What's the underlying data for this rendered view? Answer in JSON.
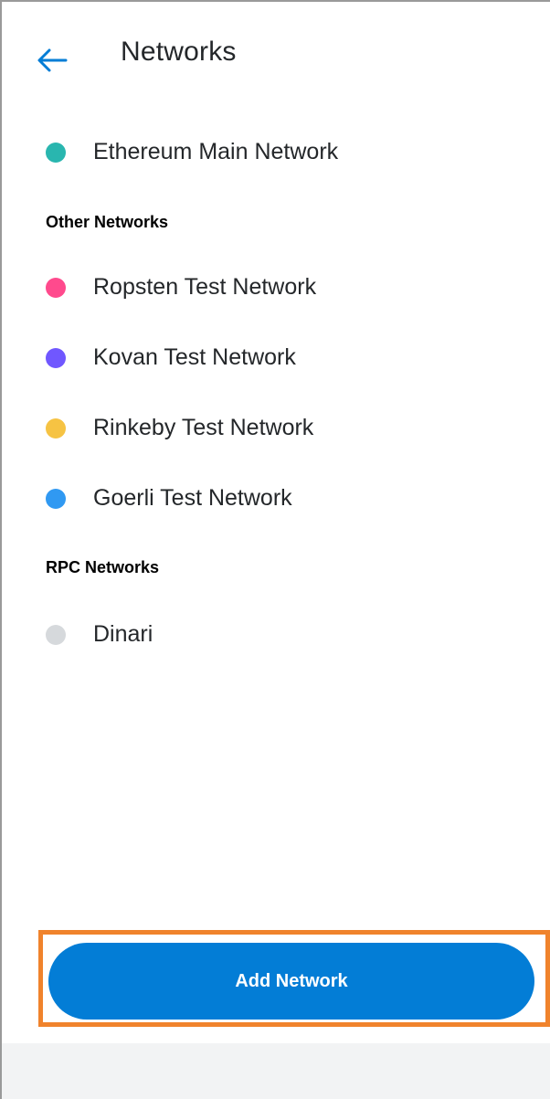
{
  "header": {
    "title": "Networks",
    "back_icon": "arrow-left-icon"
  },
  "main_network": {
    "label": "Ethereum Main Network",
    "color": "#29b6af"
  },
  "other_networks": {
    "heading": "Other Networks",
    "items": [
      {
        "label": "Ropsten Test Network",
        "color": "#ff4a8d"
      },
      {
        "label": "Kovan Test Network",
        "color": "#7057ff"
      },
      {
        "label": "Rinkeby Test Network",
        "color": "#f6c343"
      },
      {
        "label": "Goerli Test Network",
        "color": "#3099f2"
      }
    ]
  },
  "rpc_networks": {
    "heading": "RPC Networks",
    "items": [
      {
        "label": "Dinari",
        "color": "#d6d9dc"
      }
    ]
  },
  "footer": {
    "add_button_label": "Add Network",
    "accent": "#037dd6",
    "highlight_color": "#f0832c"
  }
}
